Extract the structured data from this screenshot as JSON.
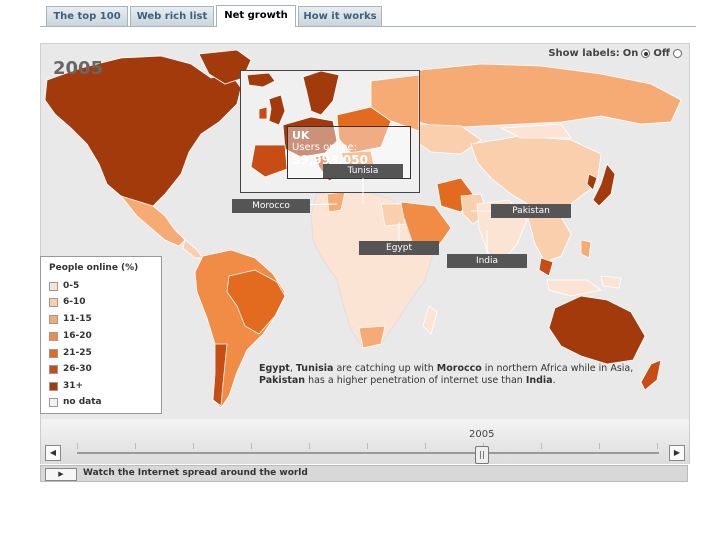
{
  "tabs": [
    {
      "label": "The top 100"
    },
    {
      "label": "Web rich list"
    },
    {
      "label": "Net growth"
    },
    {
      "label": "How it works"
    }
  ],
  "map": {
    "year": "2005",
    "show_labels": {
      "label": "Show labels:",
      "on": "On",
      "off": "Off",
      "selected": "On"
    },
    "tooltip": {
      "country": "UK",
      "label": "Users online:",
      "value": "39,993,050"
    },
    "country_labels": [
      "Tunisia",
      "Morocco",
      "Pakistan",
      "Egypt",
      "India"
    ],
    "caption": {
      "p1": "Egypt",
      "p2": ", ",
      "p3": "Tunisia",
      "p4": " are catching up with ",
      "p5": "Morocco",
      "p6": " in northern Africa while in Asia, ",
      "p7": "Pakistan",
      "p8": " has a higher penetration of internet use than ",
      "p9": "India",
      "p10": "."
    },
    "colors": {
      "ocean": "#e9e9e9",
      "c0": "#fbe4d3",
      "c1": "#f9cfae",
      "c2": "#f6ab74",
      "c3": "#f08c46",
      "c4": "#e36b1f",
      "c5": "#c84d14",
      "c6": "#a33a0b",
      "nodata": "#f2f2f2"
    }
  },
  "legend": {
    "title": "People online (%)",
    "items": [
      {
        "label": "0-5",
        "color": "#fbe4d3"
      },
      {
        "label": "6-10",
        "color": "#f9cfae"
      },
      {
        "label": "11-15",
        "color": "#f6ab74"
      },
      {
        "label": "16-20",
        "color": "#f08c46"
      },
      {
        "label": "21-25",
        "color": "#e36b1f"
      },
      {
        "label": "26-30",
        "color": "#c84d14"
      },
      {
        "label": "31+",
        "color": "#a33a0b"
      },
      {
        "label": "no data",
        "color": "#f2f2f2"
      }
    ]
  },
  "timeline": {
    "year": "2005",
    "play_label": "Watch the Internet spread around the world"
  }
}
